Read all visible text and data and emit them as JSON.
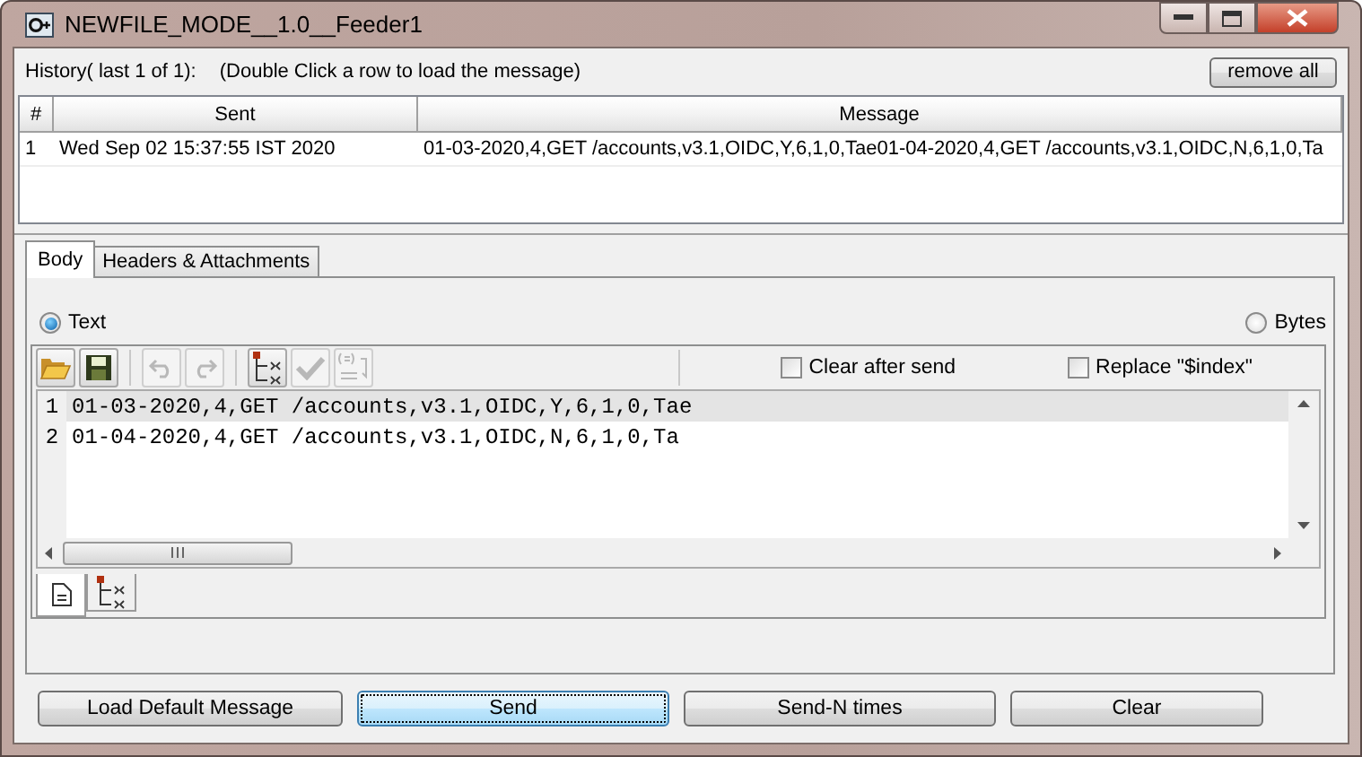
{
  "window": {
    "title": "NEWFILE_MODE__1.0__Feeder1"
  },
  "history": {
    "label": "History( last 1 of 1):",
    "hint": "(Double Click a row to load the message)",
    "remove_button": "remove all"
  },
  "table": {
    "columns": [
      "#",
      "Sent",
      "Message"
    ],
    "rows": [
      {
        "cells": [
          "1",
          "Wed Sep 02 15:37:55 IST 2020",
          "01-03-2020,4,GET /accounts,v3.1,OIDC,Y,6,1,0,Tae01-04-2020,4,GET /accounts,v3.1,OIDC,N,6,1,0,Ta"
        ],
        "selected": false
      }
    ]
  },
  "tabs": [
    {
      "label": "Body",
      "selected": true
    },
    {
      "label": "Headers & Attachments",
      "selected": false
    }
  ],
  "format_options": [
    {
      "label": "Text",
      "selected": true
    },
    {
      "label": "Bytes",
      "selected": false
    }
  ],
  "toolbar": [
    {
      "kind": "open",
      "disabled": false
    },
    {
      "kind": "save",
      "disabled": false
    },
    {
      "kind": "separator"
    },
    {
      "kind": "undo",
      "disabled": true
    },
    {
      "kind": "redo",
      "disabled": true
    },
    {
      "kind": "separator"
    },
    {
      "kind": "tree",
      "disabled": false
    },
    {
      "kind": "check",
      "disabled": true
    },
    {
      "kind": "xml",
      "disabled": true
    }
  ],
  "checkboxes": [
    {
      "label": "Clear after send",
      "checked": false
    },
    {
      "label": "Replace \"$index\"",
      "checked": false
    }
  ],
  "editor": {
    "lines": [
      {
        "number": "1",
        "text": "01-03-2020,4,GET /accounts,v3.1,OIDC,Y,6,1,0,Tae",
        "highlighted": true
      },
      {
        "number": "2",
        "text": "01-04-2020,4,GET /accounts,v3.1,OIDC,N,6,1,0,Ta",
        "highlighted": false
      }
    ]
  },
  "view_tabs": [
    {
      "kind": "text",
      "selected": true
    },
    {
      "kind": "tree",
      "selected": false
    }
  ],
  "buttons": [
    {
      "label": "Load Default Message",
      "focused": false
    },
    {
      "label": "Send",
      "focused": true
    },
    {
      "label": "Send-N times",
      "focused": false
    },
    {
      "label": "Clear",
      "focused": false
    }
  ]
}
